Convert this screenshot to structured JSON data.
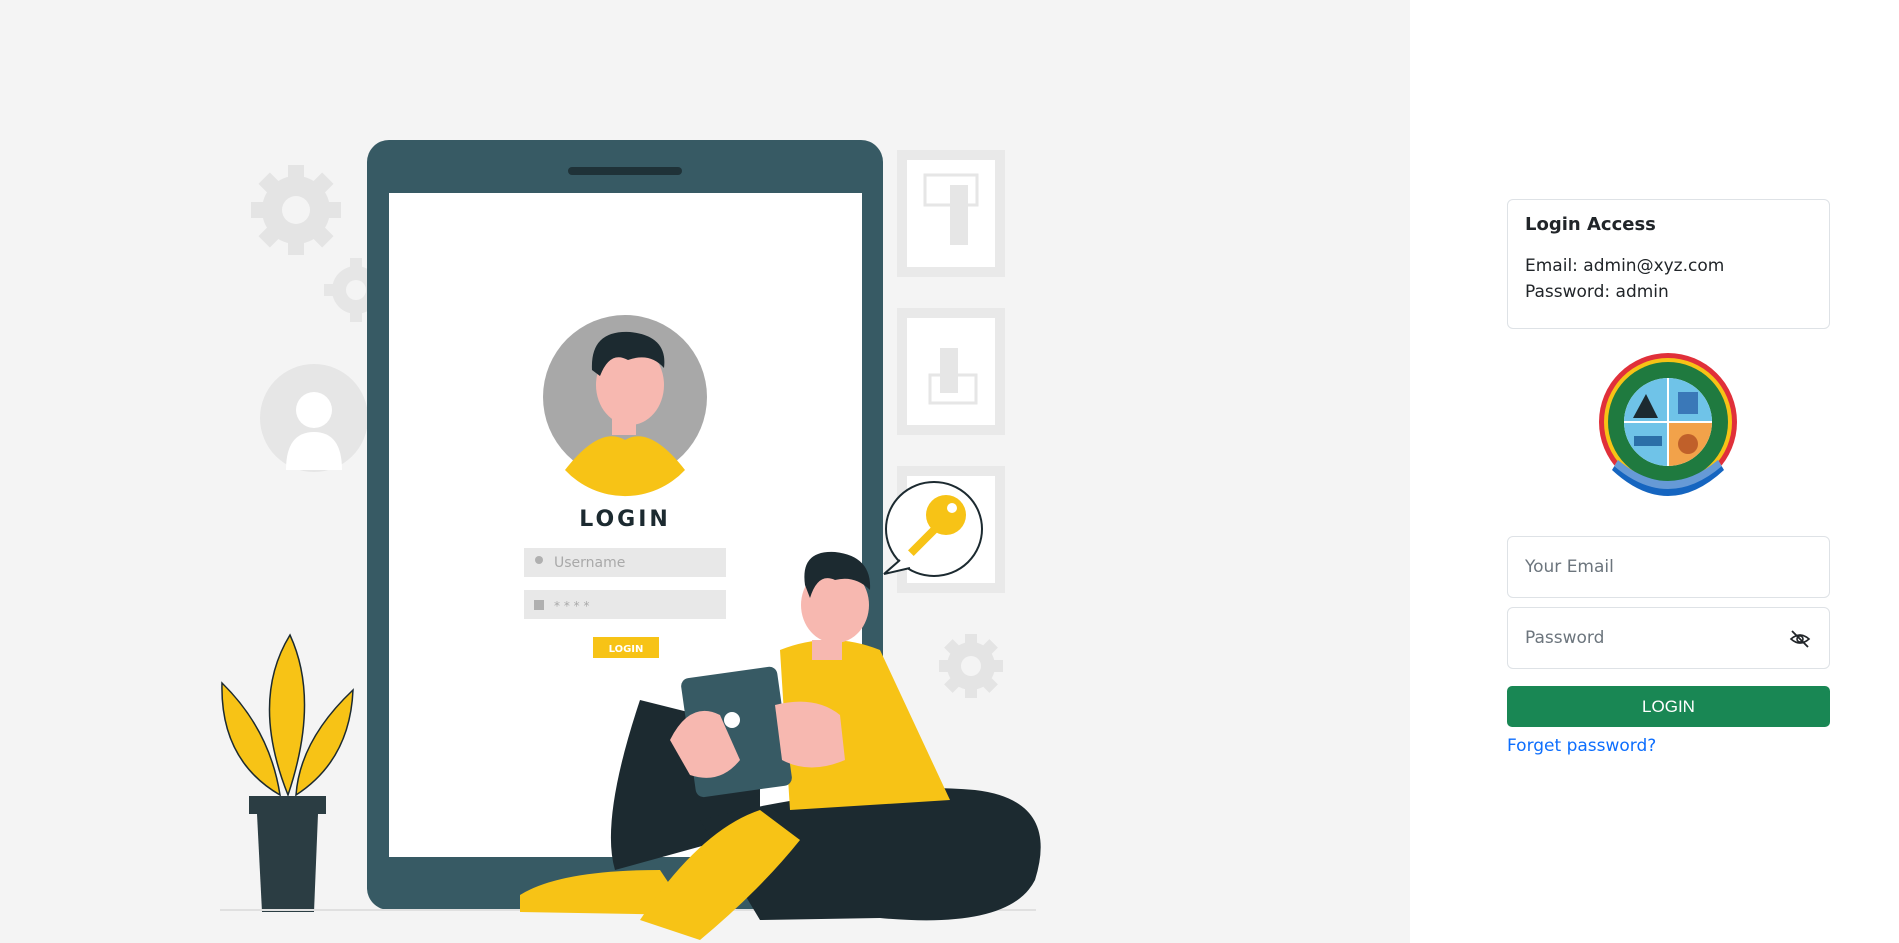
{
  "illustration": {
    "phone_title": "LOGIN",
    "phone_username_placeholder": "Username",
    "phone_password_mask": "* * * *",
    "phone_button_label": "LOGIN"
  },
  "info_card": {
    "title": "Login Access",
    "email_line": "Email: admin@xyz.com",
    "password_line": "Password: admin"
  },
  "seal": {
    "name": "district-council-seal"
  },
  "form": {
    "email_placeholder": "Your Email",
    "password_placeholder": "Password",
    "login_label": "LOGIN",
    "forget_label": "Forget password?"
  },
  "colors": {
    "primary": "#198754",
    "link": "#0d6efd",
    "phone_frame": "#375a64",
    "accent_yellow": "#f7c316"
  }
}
